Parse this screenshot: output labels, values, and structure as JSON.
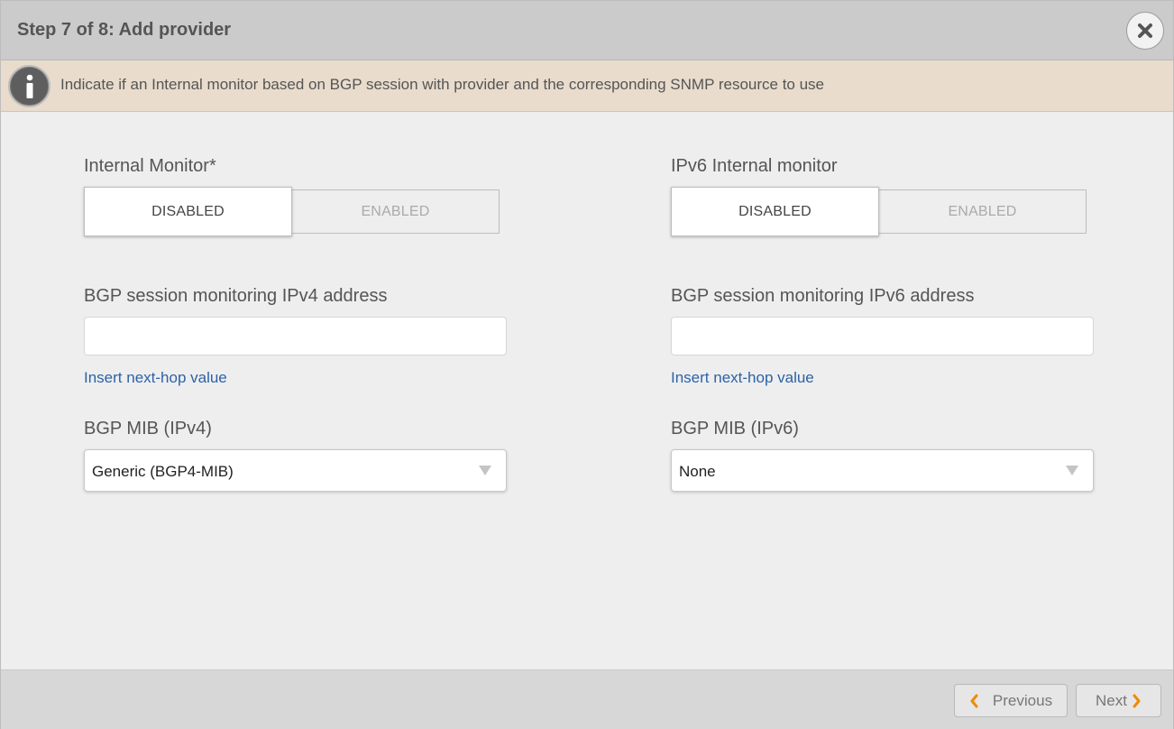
{
  "header": {
    "title": "Step 7 of 8: Add provider",
    "close_icon": "close-icon"
  },
  "info": {
    "icon": "info-icon",
    "text": "Indicate if an Internal monitor based on BGP session with provider and the corresponding SNMP resource to use"
  },
  "left": {
    "internal_monitor": {
      "label": "Internal Monitor*",
      "options": [
        "DISABLED",
        "ENABLED"
      ],
      "selected": "DISABLED"
    },
    "bgp_address": {
      "label": "BGP session monitoring IPv4 address",
      "value": "",
      "link": "Insert next-hop value"
    },
    "bgp_mib": {
      "label": "BGP MIB (IPv4)",
      "selected": "Generic (BGP4-MIB)"
    }
  },
  "right": {
    "internal_monitor": {
      "label": "IPv6 Internal monitor",
      "options": [
        "DISABLED",
        "ENABLED"
      ],
      "selected": "DISABLED"
    },
    "bgp_address": {
      "label": "BGP session monitoring IPv6 address",
      "value": "",
      "link": "Insert next-hop value"
    },
    "bgp_mib": {
      "label": "BGP MIB (IPv6)",
      "selected": "None"
    }
  },
  "footer": {
    "previous_label": "Previous",
    "next_label": "Next",
    "accent_color": "#f08a00"
  }
}
